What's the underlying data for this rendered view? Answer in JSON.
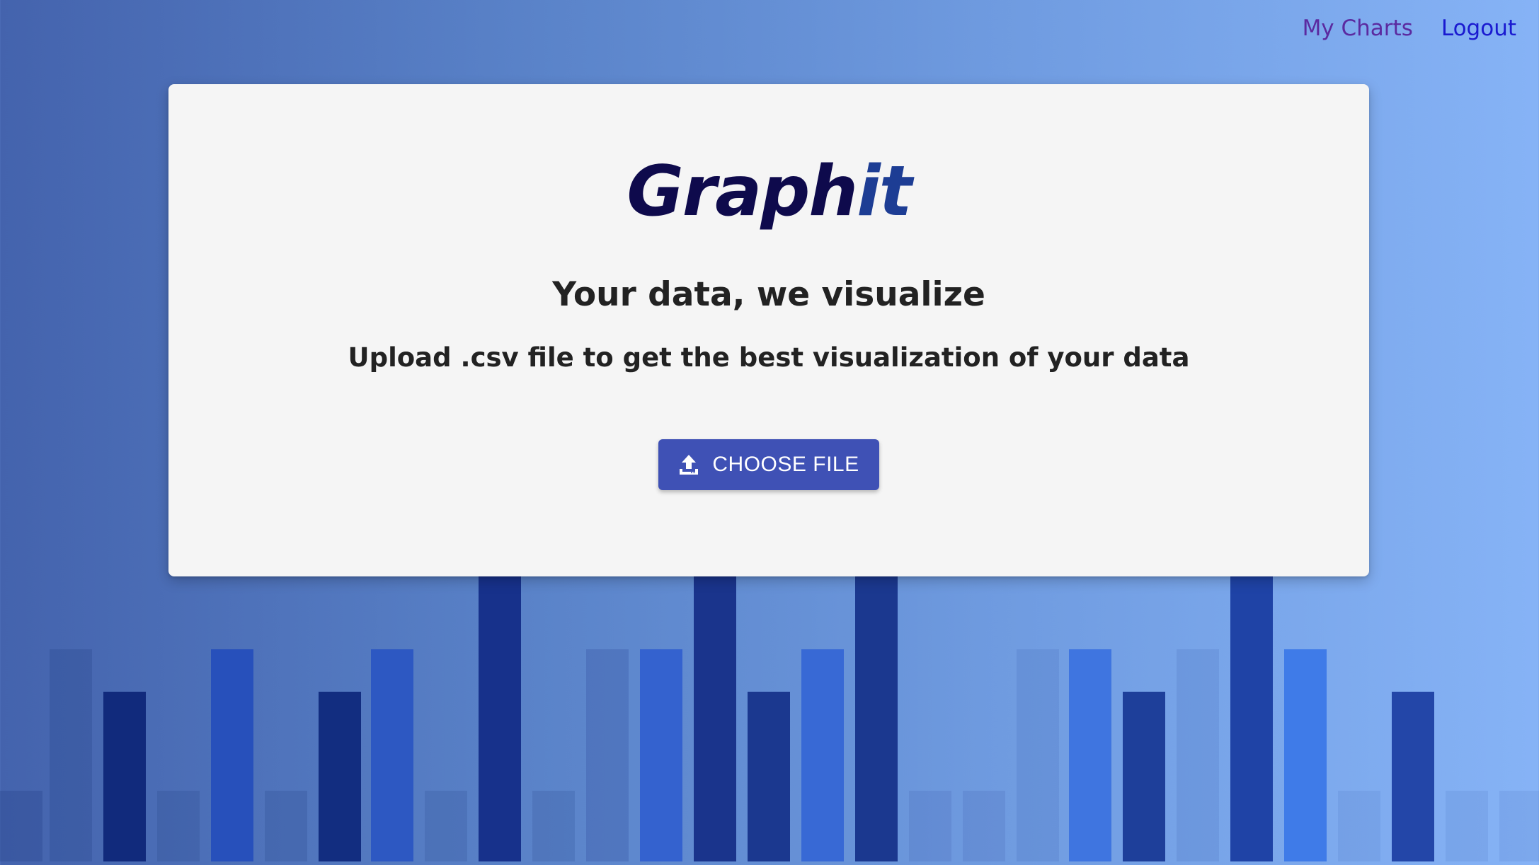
{
  "nav": {
    "my_charts_label": "My Charts",
    "logout_label": "Logout",
    "my_charts_color": "#5b2aa0",
    "logout_color": "#1a1ad0"
  },
  "card": {
    "logo_main": "Graph",
    "logo_accent": "it",
    "headline": "Your data, we visualize",
    "subline": "Upload .csv file to get the best visualization of your data",
    "button_label": "CHOOSE FILE",
    "button_icon": "upload-icon",
    "button_color": "#3f51b5"
  },
  "colors": {
    "background_left": "#4463ad",
    "background_right": "#86b3f6",
    "card_background": "#f5f5f5",
    "logo_main": "#0e0a4c",
    "logo_accent": "#1d3d94"
  }
}
